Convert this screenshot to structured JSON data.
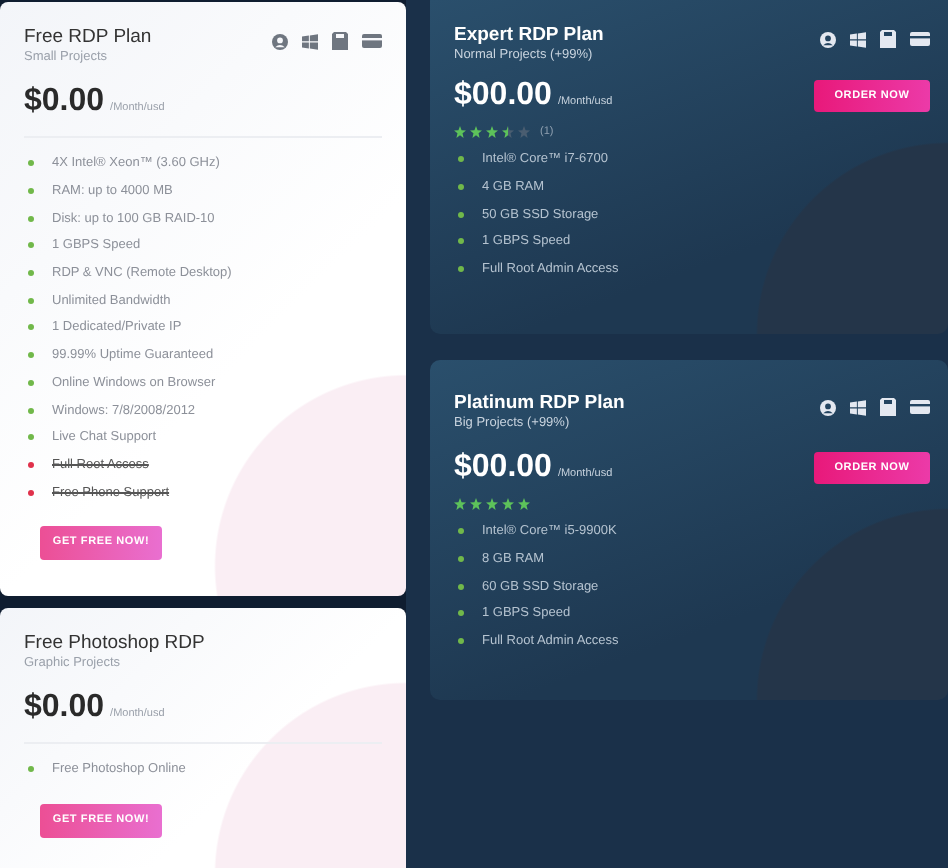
{
  "columns": [
    {
      "plans": [
        {
          "kind": "light",
          "title": "Free RDP Plan",
          "subtitle": "Small Projects",
          "price": "$0.00",
          "period": "/Month/usd",
          "features": [
            {
              "text": "4X Intel® Xeon™ (3.60 GHz)",
              "included": true
            },
            {
              "text": "RAM: up to 4000 MB",
              "included": true
            },
            {
              "text": "Disk: up to 100 GB RAID-10",
              "included": true
            },
            {
              "text": "1 GBPS Speed",
              "included": true
            },
            {
              "text": "RDP & VNC (Remote Desktop)",
              "included": true
            },
            {
              "text": "Unlimited Bandwidth",
              "included": true
            },
            {
              "text": "1 Dedicated/Private IP",
              "included": true
            },
            {
              "text": "99.99% Uptime Guaranteed",
              "included": true
            },
            {
              "text": "Online Windows on Browser",
              "included": true
            },
            {
              "text": "Windows: 7/8/2008/2012",
              "included": true
            },
            {
              "text": "Live Chat Support",
              "included": true
            },
            {
              "text": "Full Root Access",
              "included": false
            },
            {
              "text": "Free Phone Support",
              "included": false
            }
          ],
          "button": "GET FREE NOW!",
          "icons": true
        },
        {
          "kind": "light",
          "title": "Free Photoshop RDP",
          "subtitle": "Graphic Projects",
          "price": "$0.00",
          "period": "/Month/usd",
          "features": [
            {
              "text": "Free Photoshop Online",
              "included": true
            }
          ],
          "button": "GET FREE NOW!",
          "icons": false
        }
      ]
    },
    {
      "plans": [
        {
          "kind": "dark",
          "title": "Expert RDP Plan",
          "subtitle": "Normal Projects (+99%)",
          "price": "$00.00",
          "period": "/Month/usd",
          "stars": 3.5,
          "reviews": "(1)",
          "features": [
            {
              "text": "Intel® Core™ i7-6700",
              "included": true
            },
            {
              "text": "4 GB RAM",
              "included": true
            },
            {
              "text": "50 GB SSD Storage",
              "included": true
            },
            {
              "text": "1 GBPS Speed",
              "included": true
            },
            {
              "text": "Full Root Admin Access",
              "included": true
            }
          ],
          "button": "ORDER NOW",
          "icons": true
        },
        {
          "kind": "dark",
          "title": "Platinum RDP Plan",
          "subtitle": "Big Projects (+99%)",
          "price": "$00.00",
          "period": "/Month/usd",
          "stars": 5,
          "features": [
            {
              "text": "Intel® Core™ i5-9900K",
              "included": true
            },
            {
              "text": "8 GB RAM",
              "included": true
            },
            {
              "text": "60 GB SSD Storage",
              "included": true
            },
            {
              "text": "1 GBPS Speed",
              "included": true
            },
            {
              "text": "Full Root Admin Access",
              "included": true
            }
          ],
          "button": "ORDER NOW",
          "icons": true
        }
      ]
    }
  ]
}
